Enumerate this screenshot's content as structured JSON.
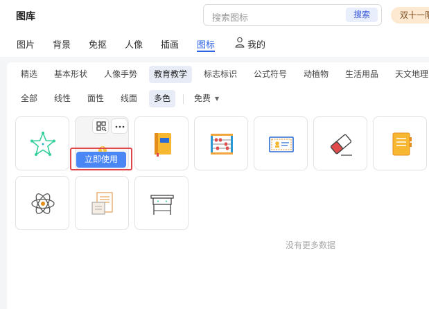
{
  "header": {
    "title": "图库",
    "search": {
      "placeholder": "搜索图标",
      "button_label": "搜索"
    },
    "promo_label": "双十一限"
  },
  "top_tabs": [
    {
      "label": "图片"
    },
    {
      "label": "背景"
    },
    {
      "label": "免抠"
    },
    {
      "label": "人像"
    },
    {
      "label": "插画"
    },
    {
      "label": "图标",
      "active": true
    },
    {
      "label": "我的",
      "icon": "user-icon"
    }
  ],
  "categories": [
    {
      "label": "精选"
    },
    {
      "label": "基本形状"
    },
    {
      "label": "人像手势"
    },
    {
      "label": "教育教学",
      "active": true
    },
    {
      "label": "标志标识"
    },
    {
      "label": "公式符号"
    },
    {
      "label": "动植物"
    },
    {
      "label": "生活用品"
    },
    {
      "label": "天文地理"
    }
  ],
  "styles": [
    {
      "label": "全部"
    },
    {
      "label": "线性"
    },
    {
      "label": "面性"
    },
    {
      "label": "线面"
    },
    {
      "label": "多色",
      "active": true
    }
  ],
  "price_filter": {
    "label": "免费",
    "icon": "caret-down-icon"
  },
  "icons": [
    {
      "name": "star-constellation-icon"
    },
    {
      "name": "lightbulb-icon",
      "hovered": true
    },
    {
      "name": "notebook-icon"
    },
    {
      "name": "abacus-icon"
    },
    {
      "name": "certificate-icon"
    },
    {
      "name": "eraser-icon"
    },
    {
      "name": "spiral-notebook-icon"
    },
    {
      "name": "atom-icon"
    },
    {
      "name": "scroll-document-icon"
    },
    {
      "name": "school-desk-icon"
    }
  ],
  "hover_actions": {
    "use_button_label": "立即使用",
    "tool_icons": [
      "qr-code-icon",
      "more-icon"
    ]
  },
  "empty_message": "没有更多数据",
  "colors": {
    "accent": "#2c62e6",
    "use_button": "#4a86f4",
    "highlight_border": "#e0474c"
  }
}
